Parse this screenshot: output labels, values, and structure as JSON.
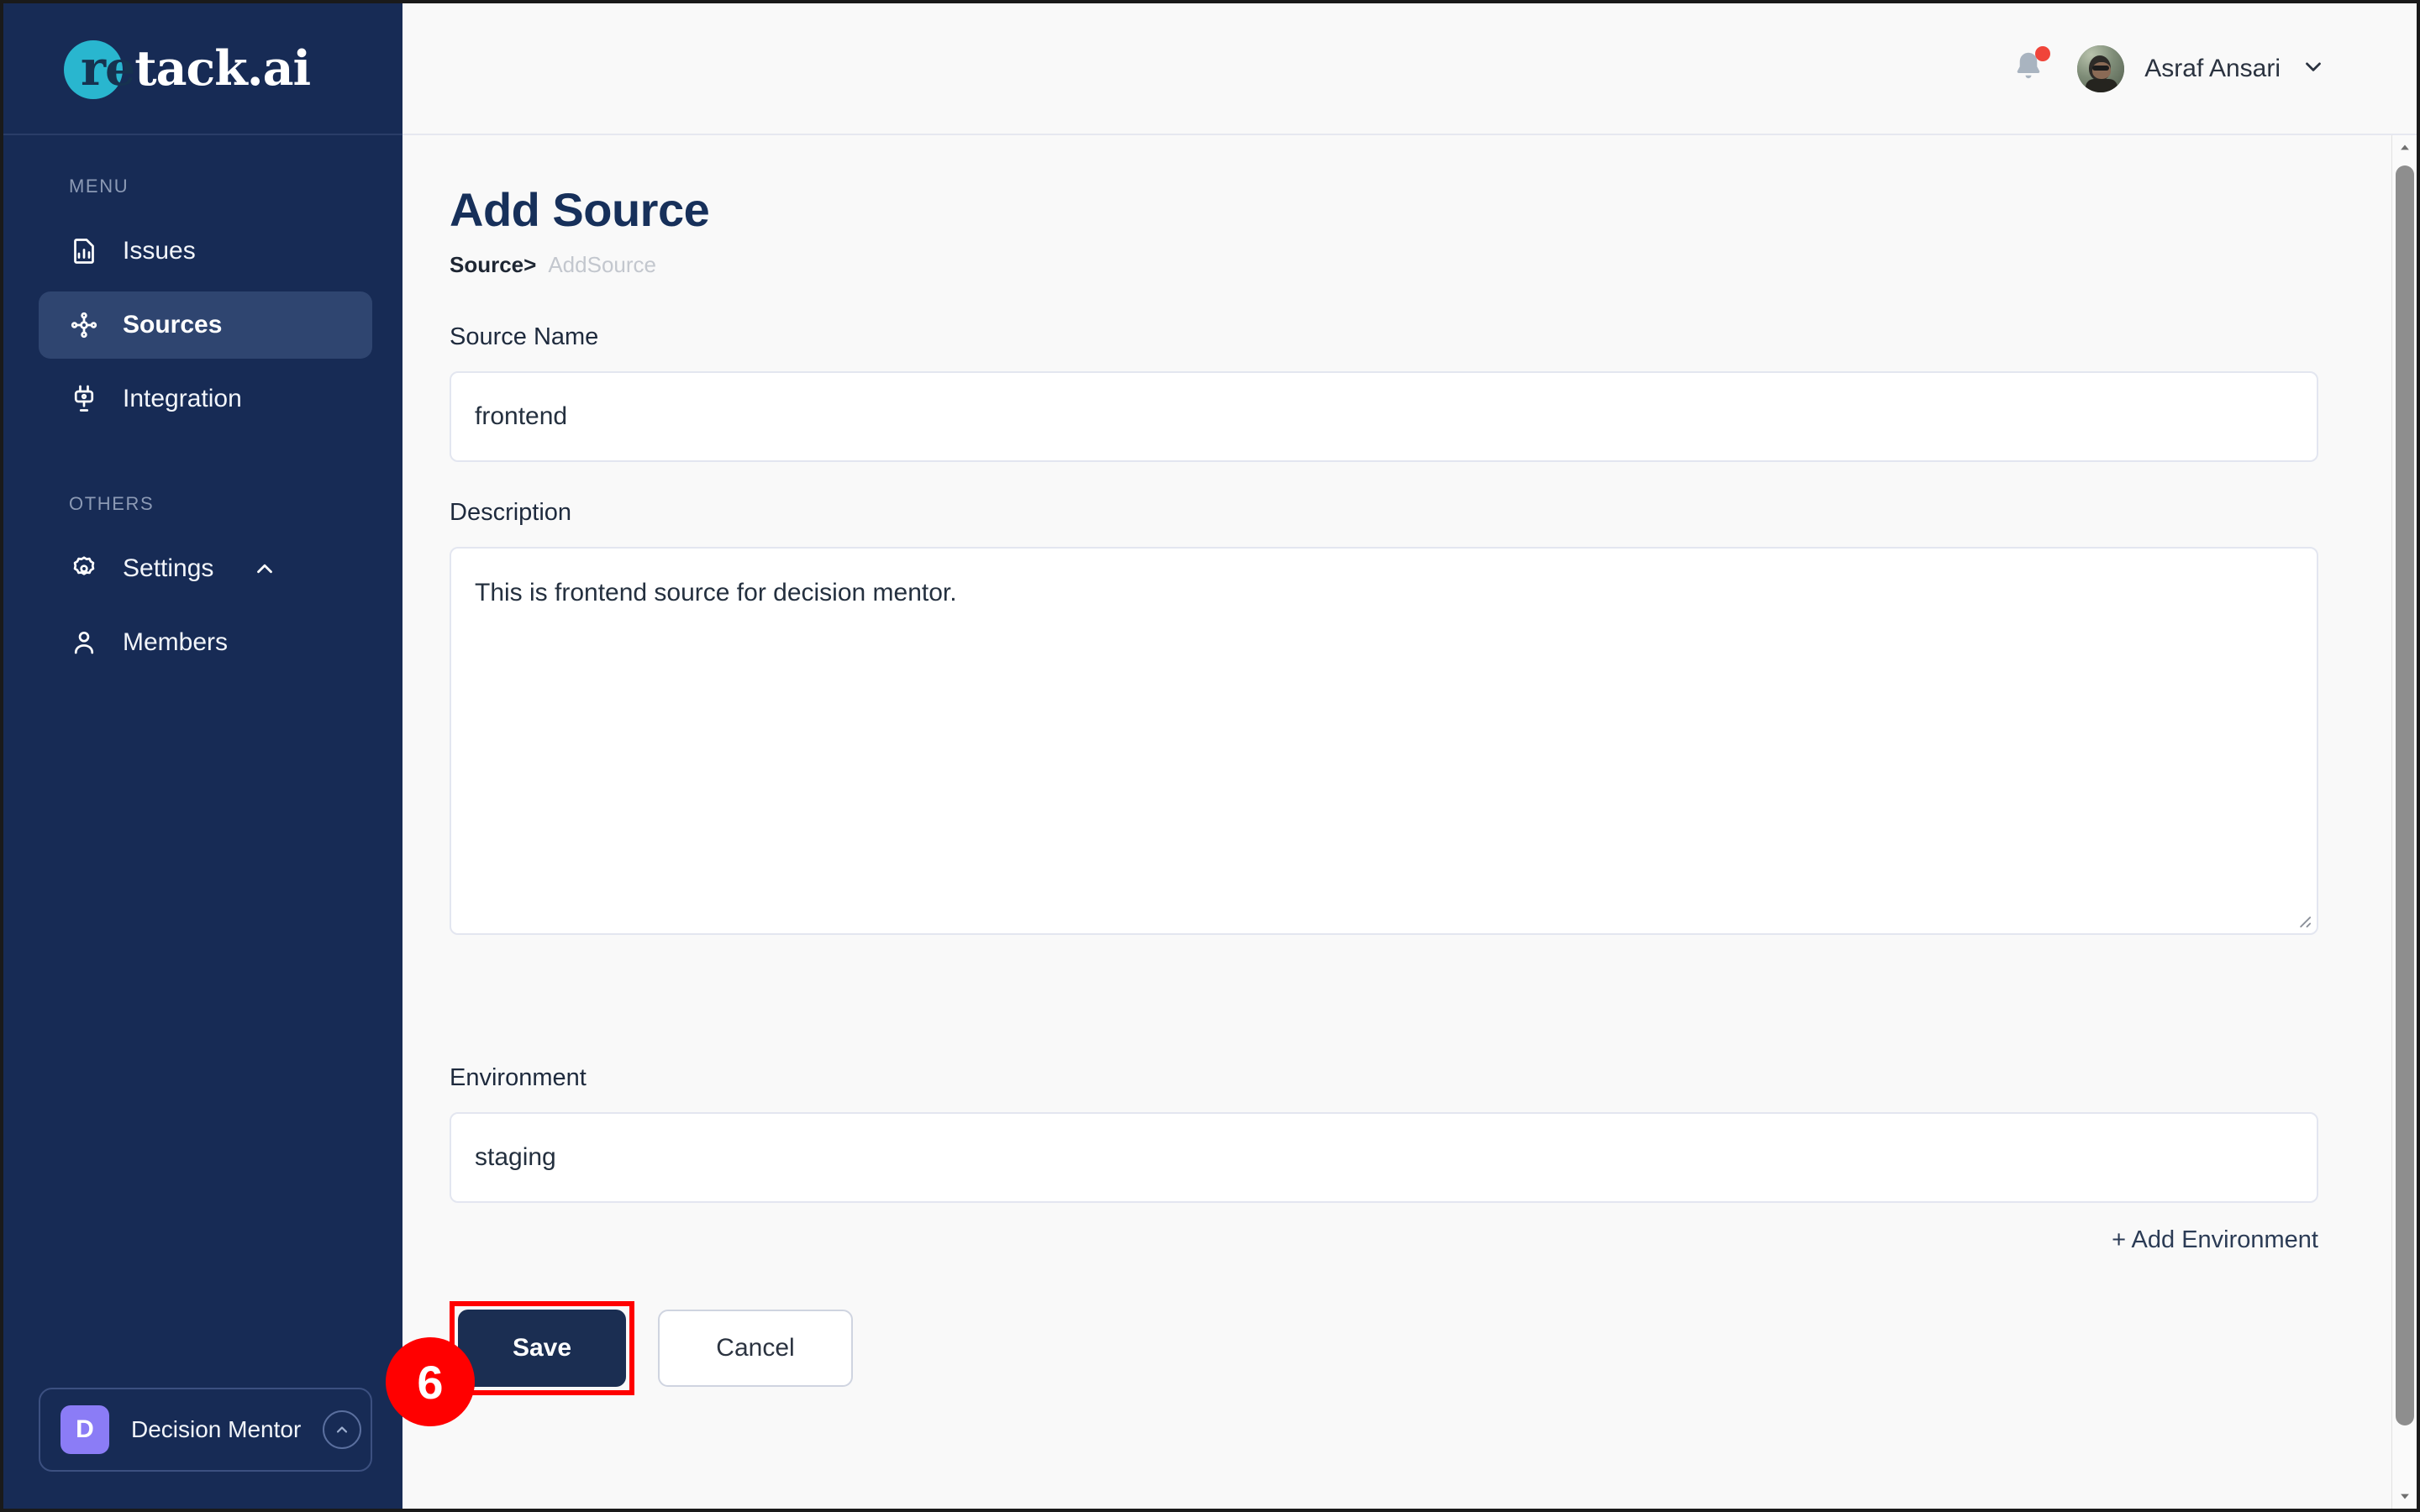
{
  "brand": {
    "logo_prefix": "re",
    "logo_suffix": "tack.ai",
    "accent_color": "#29B6CF",
    "sidebar_color": "#172B55"
  },
  "sidebar": {
    "menu_heading": "MENU",
    "menu_items": [
      {
        "label": "Issues",
        "icon": "document-chart-icon",
        "active": false
      },
      {
        "label": "Sources",
        "icon": "nodes-icon",
        "active": true
      },
      {
        "label": "Integration",
        "icon": "plug-icon",
        "active": false
      }
    ],
    "others_heading": "OTHERS",
    "others_items": [
      {
        "label": "Settings",
        "icon": "gear-icon",
        "chevron": "chevron-up-icon"
      },
      {
        "label": "Members",
        "icon": "user-icon",
        "chevron": ""
      }
    ],
    "workspace": {
      "initial": "D",
      "name": "Decision Mentor",
      "toggle_icon": "chevron-up-circle-icon",
      "avatar_color": "#8B7CF6"
    }
  },
  "topbar": {
    "notification_icon": "bell-icon",
    "has_unread": true,
    "unread_color": "#F0453A",
    "user_name": "Asraf Ansari",
    "user_menu_icon": "chevron-down-icon"
  },
  "page": {
    "title": "Add Source",
    "breadcrumb": {
      "parent": "Source",
      "separator": ">",
      "current": "AddSource"
    }
  },
  "form": {
    "source_name": {
      "label": "Source Name",
      "value": "frontend",
      "placeholder": "Source Name"
    },
    "description": {
      "label": "Description",
      "value": "This is frontend source for decision mentor.",
      "placeholder": "Description"
    },
    "environment": {
      "label": "Environment",
      "value": "staging",
      "placeholder": "Environment"
    },
    "add_environment_label": "+ Add Environment"
  },
  "actions": {
    "save_label": "Save",
    "cancel_label": "Cancel",
    "save_color": "#1B2E52"
  },
  "annotation": {
    "step_number": "6",
    "color": "#FF0000",
    "target": "save-button"
  },
  "scrollbar": {
    "up_arrow": "scroll-up-arrow-icon",
    "down_arrow": "scroll-down-arrow-icon"
  }
}
